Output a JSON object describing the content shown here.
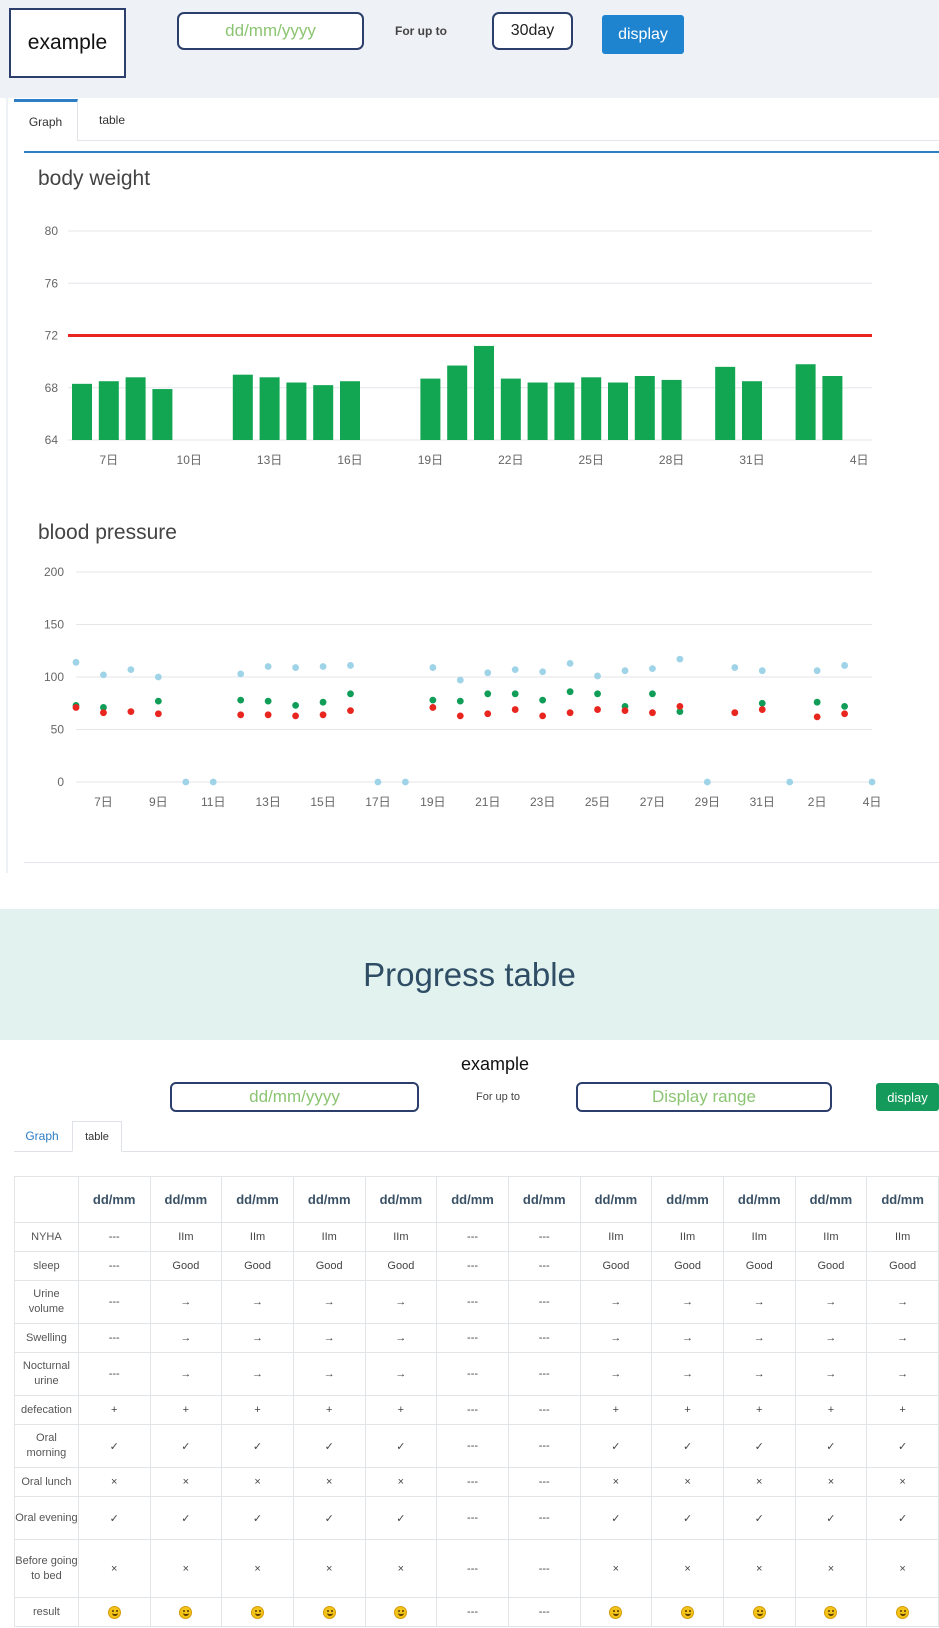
{
  "header": {
    "brand_label": "example",
    "date_placeholder": "dd/mm/yyyy",
    "for_up_to": "For up to",
    "days_value": "30day",
    "display_label": "display"
  },
  "tabs_top": {
    "graph": "Graph",
    "table": "table"
  },
  "weight_chart": {
    "title": "body weight",
    "y_ticks": [
      "80",
      "76",
      "72",
      "68",
      "64"
    ],
    "x_ticks": [
      "7日",
      "10日",
      "13日",
      "16日",
      "19日",
      "22日",
      "25日",
      "28日",
      "31日",
      "4日"
    ]
  },
  "bp_chart": {
    "title": "blood pressure",
    "y_ticks": [
      "200",
      "150",
      "100",
      "50",
      "0"
    ],
    "x_ticks": [
      "7日",
      "9日",
      "11日",
      "13日",
      "15日",
      "17日",
      "19日",
      "21日",
      "23日",
      "25日",
      "27日",
      "29日",
      "31日",
      "2日",
      "4日"
    ]
  },
  "chart_data": [
    {
      "type": "bar",
      "title": "body weight",
      "ylim": [
        64,
        80
      ],
      "threshold_line": 72,
      "threshold_color": "#e8261f",
      "bar_color": "#12a552",
      "grid": true,
      "categories": [
        "6",
        "7",
        "8",
        "9",
        "10",
        "11",
        "12",
        "13",
        "14",
        "15",
        "16",
        "17",
        "18",
        "19",
        "20",
        "21",
        "22",
        "23",
        "24",
        "25",
        "26",
        "27",
        "28",
        "29",
        "30",
        "31",
        "1",
        "2",
        "3",
        "4"
      ],
      "x_tick_labels": [
        "7日",
        "10日",
        "13日",
        "16日",
        "19日",
        "22日",
        "25日",
        "28日",
        "31日",
        "4日"
      ],
      "values": [
        68.3,
        68.5,
        68.8,
        67.9,
        null,
        null,
        69.0,
        68.8,
        68.4,
        68.2,
        68.5,
        null,
        null,
        68.7,
        69.7,
        71.2,
        68.7,
        68.4,
        68.4,
        68.8,
        68.4,
        68.9,
        68.6,
        null,
        69.6,
        68.5,
        null,
        69.8,
        68.9,
        null
      ]
    },
    {
      "type": "scatter",
      "title": "blood pressure",
      "ylim": [
        0,
        200
      ],
      "grid": true,
      "x": [
        "6",
        "7",
        "8",
        "9",
        "10",
        "11",
        "12",
        "13",
        "14",
        "15",
        "16",
        "17",
        "18",
        "19",
        "20",
        "21",
        "22",
        "23",
        "24",
        "25",
        "26",
        "27",
        "28",
        "29",
        "30",
        "31",
        "1",
        "2",
        "3",
        "4"
      ],
      "x_tick_labels": [
        "7日",
        "9日",
        "11日",
        "13日",
        "15日",
        "17日",
        "19日",
        "21日",
        "23日",
        "25日",
        "27日",
        "29日",
        "31日",
        "2日",
        "4日"
      ],
      "series": [
        {
          "color": "#9fd3e8",
          "values": [
            114,
            102,
            107,
            100,
            0,
            0,
            103,
            110,
            109,
            110,
            111,
            0,
            0,
            109,
            97,
            104,
            107,
            105,
            113,
            101,
            106,
            108,
            117,
            0,
            109,
            106,
            0,
            106,
            111,
            0
          ]
        },
        {
          "color": "#0f9d58",
          "values": [
            73,
            71,
            null,
            77,
            null,
            null,
            78,
            77,
            73,
            76,
            84,
            null,
            null,
            78,
            77,
            84,
            84,
            78,
            86,
            84,
            72,
            84,
            67,
            null,
            null,
            75,
            null,
            76,
            72,
            null
          ]
        },
        {
          "color": "#e8261f",
          "values": [
            71,
            66,
            67,
            65,
            null,
            null,
            64,
            64,
            63,
            64,
            68,
            null,
            null,
            71,
            63,
            65,
            69,
            63,
            66,
            69,
            68,
            66,
            72,
            null,
            66,
            69,
            null,
            62,
            65,
            null
          ]
        }
      ]
    }
  ],
  "banner": {
    "title": "Progress table"
  },
  "lower_form": {
    "example_label": "example",
    "date_placeholder": "dd/mm/yyyy",
    "for_up_to": "For up to",
    "range_placeholder": "Display range",
    "display_label": "display"
  },
  "tabs_bottom": {
    "graph": "Graph",
    "table": "table"
  },
  "progress_table": {
    "columns": [
      "dd/mm",
      "dd/mm",
      "dd/mm",
      "dd/mm",
      "dd/mm",
      "dd/mm",
      "dd/mm",
      "dd/mm",
      "dd/mm",
      "dd/mm",
      "dd/mm",
      "dd/mm"
    ],
    "rows": [
      {
        "label": "NYHA",
        "cells": [
          "---",
          "IIm",
          "IIm",
          "IIm",
          "IIm",
          "---",
          "---",
          "IIm",
          "IIm",
          "IIm",
          "IIm",
          "IIm"
        ]
      },
      {
        "label": "sleep",
        "cells": [
          "---",
          "Good",
          "Good",
          "Good",
          "Good",
          "---",
          "---",
          "Good",
          "Good",
          "Good",
          "Good",
          "Good"
        ]
      },
      {
        "label": "Urine volume",
        "cells": [
          "---",
          "→",
          "→",
          "→",
          "→",
          "---",
          "---",
          "→",
          "→",
          "→",
          "→",
          "→"
        ]
      },
      {
        "label": "Swelling",
        "cells": [
          "---",
          "→",
          "→",
          "→",
          "→",
          "---",
          "---",
          "→",
          "→",
          "→",
          "→",
          "→"
        ]
      },
      {
        "label": "Nocturnal urine",
        "cells": [
          "---",
          "→",
          "→",
          "→",
          "→",
          "---",
          "---",
          "→",
          "→",
          "→",
          "→",
          "→"
        ]
      },
      {
        "label": "defecation",
        "cells": [
          "+",
          "+",
          "+",
          "+",
          "+",
          "---",
          "---",
          "+",
          "+",
          "+",
          "+",
          "+"
        ]
      },
      {
        "label": "Oral morning",
        "cells": [
          "✓",
          "✓",
          "✓",
          "✓",
          "✓",
          "---",
          "---",
          "✓",
          "✓",
          "✓",
          "✓",
          "✓"
        ]
      },
      {
        "label": "Oral lunch",
        "cells": [
          "×",
          "×",
          "×",
          "×",
          "×",
          "---",
          "---",
          "×",
          "×",
          "×",
          "×",
          "×"
        ]
      },
      {
        "label": "Oral evening",
        "cells": [
          "✓",
          "✓",
          "✓",
          "✓",
          "✓",
          "---",
          "---",
          "✓",
          "✓",
          "✓",
          "✓",
          "✓"
        ]
      },
      {
        "label": "Before going to bed",
        "cells": [
          "×",
          "×",
          "×",
          "×",
          "×",
          "---",
          "---",
          "×",
          "×",
          "×",
          "×",
          "×"
        ]
      },
      {
        "label": "result",
        "cells": [
          "smiley",
          "smiley",
          "smiley",
          "smiley",
          "smiley",
          "---",
          "---",
          "smiley",
          "smiley",
          "smiley",
          "smiley",
          "smiley"
        ]
      }
    ]
  }
}
